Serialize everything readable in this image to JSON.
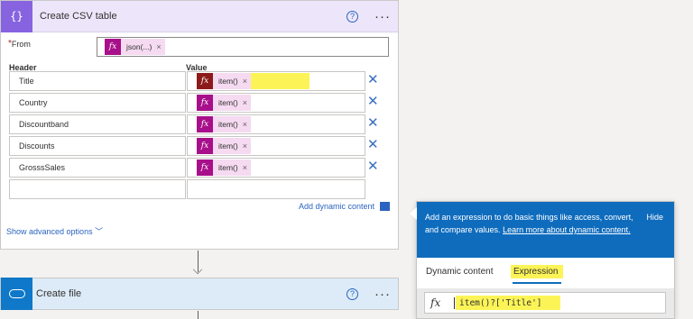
{
  "card1": {
    "title": "Create CSV table",
    "icon": "curly-braces-icon",
    "from_label": "From",
    "from_token": "json(...)",
    "header_col": "Header",
    "value_col": "Value",
    "rows": [
      {
        "header": "Title",
        "value": "item()"
      },
      {
        "header": "Country",
        "value": "item()"
      },
      {
        "header": "Discountband",
        "value": "item()"
      },
      {
        "header": "Discounts",
        "value": "item()"
      },
      {
        "header": "GrosssSales",
        "value": "item()"
      }
    ],
    "add_dynamic": "Add dynamic content",
    "show_advanced": "Show advanced options"
  },
  "card2": {
    "title": "Create file",
    "icon": "onedrive-cloud-icon"
  },
  "popup": {
    "message_part1": "Add an expression to do basic things like access, convert, and compare values.",
    "link": "Learn more about dynamic content.",
    "hide": "Hide",
    "tab_dynamic": "Dynamic content",
    "tab_expression": "Expression",
    "expression": "item()?['Title']"
  },
  "colors": {
    "csv_accent": "#8763e0",
    "file_accent": "#0f78c8",
    "token": "#a80f8a",
    "popup_blue": "#0f6cbd",
    "highlight": "#fbf23a"
  }
}
